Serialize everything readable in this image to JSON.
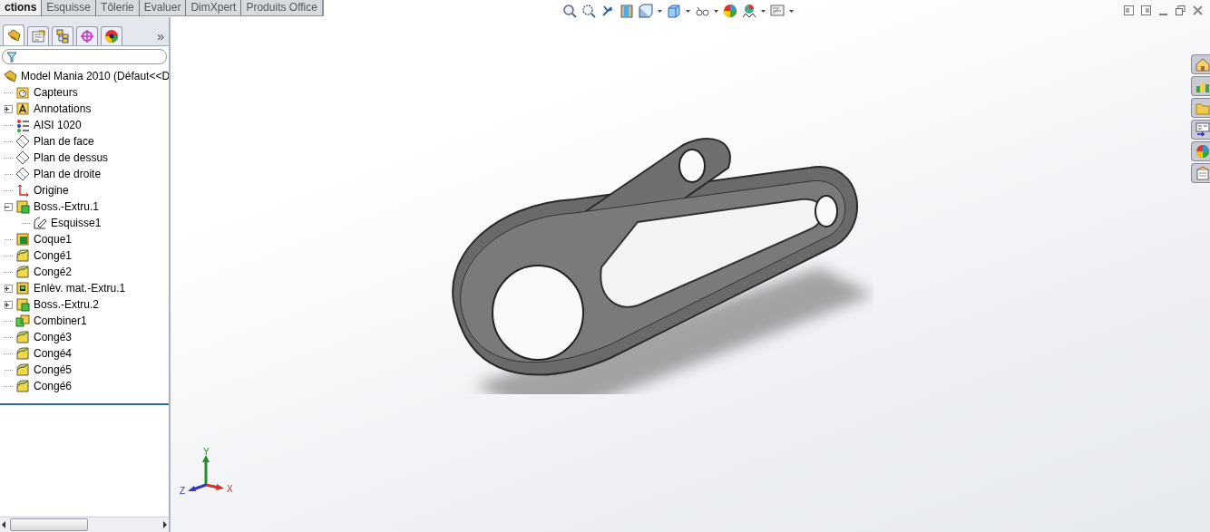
{
  "command_tabs": [
    {
      "label": "ctions",
      "selected": true
    },
    {
      "label": "Esquisse",
      "selected": false
    },
    {
      "label": "Tôlerie",
      "selected": false
    },
    {
      "label": "Evaluer",
      "selected": false
    },
    {
      "label": "DimXpert",
      "selected": false
    },
    {
      "label": "Produits Office",
      "selected": false
    }
  ],
  "feature_manager": {
    "more_tabs": "»",
    "tree": {
      "label": "Model Mania 2010  (Défaut<<D",
      "kind": "part",
      "children": [
        {
          "label": "Capteurs",
          "kind": "sensor"
        },
        {
          "label": "Annotations",
          "kind": "annotation",
          "expanded": false
        },
        {
          "label": "AISI 1020",
          "kind": "material"
        },
        {
          "label": "Plan de face",
          "kind": "plane"
        },
        {
          "label": "Plan de dessus",
          "kind": "plane"
        },
        {
          "label": "Plan de droite",
          "kind": "plane"
        },
        {
          "label": "Origine",
          "kind": "origin"
        },
        {
          "label": "Boss.-Extru.1",
          "kind": "boss",
          "expanded": true,
          "children": [
            {
              "label": "Esquisse1",
              "kind": "sketch"
            }
          ]
        },
        {
          "label": "Coque1",
          "kind": "shell"
        },
        {
          "label": "Congé1",
          "kind": "fillet"
        },
        {
          "label": "Congé2",
          "kind": "fillet"
        },
        {
          "label": "Enlèv. mat.-Extru.1",
          "kind": "cut",
          "expanded": false
        },
        {
          "label": "Boss.-Extru.2",
          "kind": "boss",
          "expanded": false
        },
        {
          "label": "Combiner1",
          "kind": "combine"
        },
        {
          "label": "Congé3",
          "kind": "fillet"
        },
        {
          "label": "Congé4",
          "kind": "fillet"
        },
        {
          "label": "Congé5",
          "kind": "fillet"
        },
        {
          "label": "Congé6",
          "kind": "fillet"
        }
      ]
    }
  },
  "triad": {
    "x": "X",
    "y": "Y",
    "z": "Z"
  }
}
